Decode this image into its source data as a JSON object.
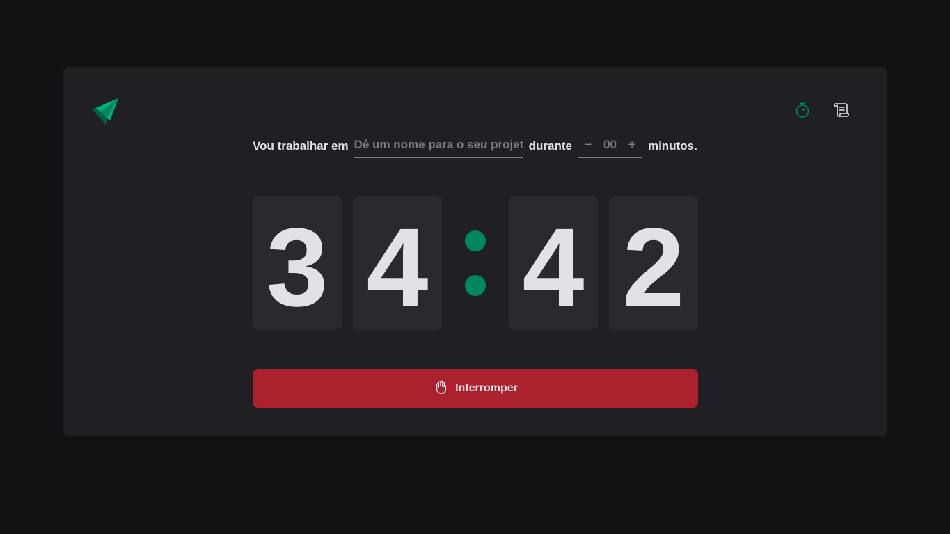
{
  "nav": {
    "timer_icon": "timer-icon",
    "history_icon": "scroll-icon"
  },
  "form": {
    "label_task": "Vou trabalhar em",
    "task_placeholder": "Dê um nome para o seu projeto",
    "task_value": "",
    "label_during": "durante",
    "minus_label": "−",
    "minutes_value": "00",
    "plus_label": "+",
    "label_minutes": "minutos."
  },
  "countdown": {
    "minutes_tens": "3",
    "minutes_ones": "4",
    "seconds_tens": "4",
    "seconds_ones": "2"
  },
  "stop_button": {
    "label": "Interromper",
    "icon": "hand-palm-icon"
  },
  "colors": {
    "background": "#121214",
    "card": "#202024",
    "digit_bg": "#29292e",
    "accent_green": "#00875f",
    "danger_red": "#ab222e",
    "text": "#e1e1e6",
    "muted": "#7c7c8a"
  }
}
